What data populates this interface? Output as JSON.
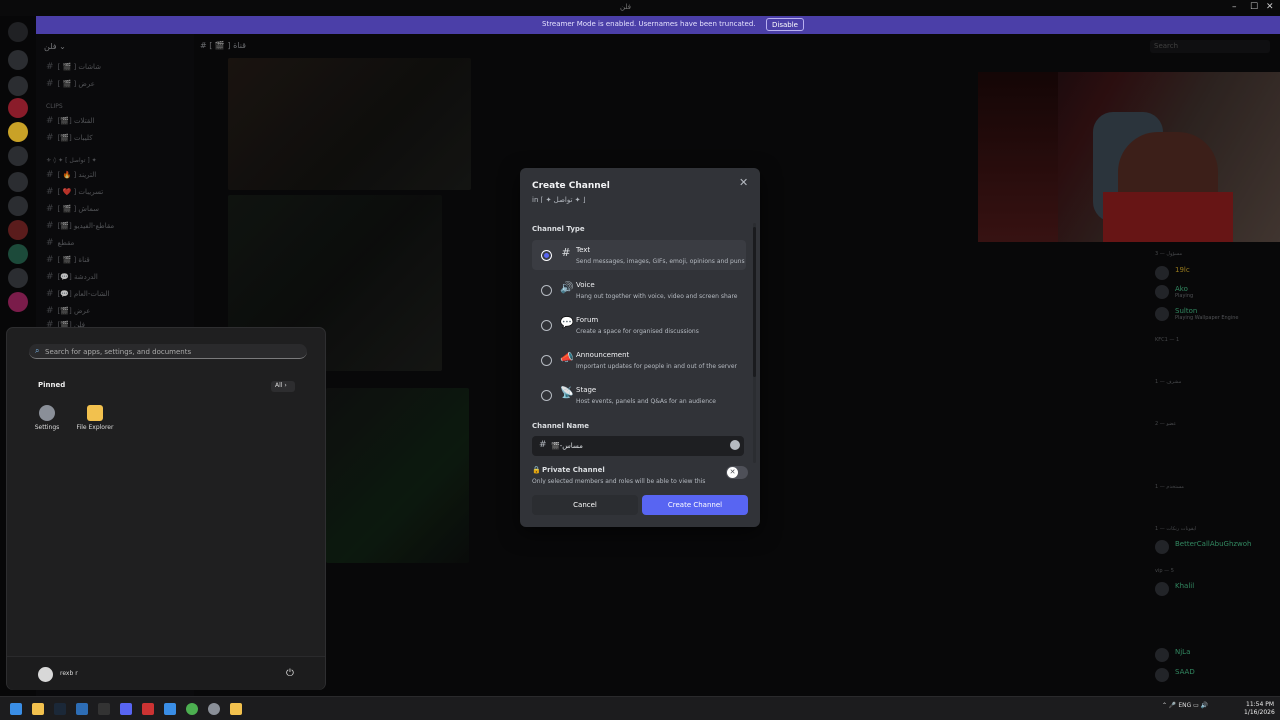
{
  "window": {
    "title": "فلن"
  },
  "banner": {
    "text": "Streamer Mode is enabled. Usernames have been truncated.",
    "disable_label": "Disable"
  },
  "server": {
    "name": "فلن ⌄"
  },
  "channel_list": {
    "items": [
      {
        "label": "[ 🎬 ] شاشات"
      },
      {
        "label": "[ 🎬 ] عرض"
      },
      {
        "label": "[🎬] القتلات"
      },
      {
        "label": "[🎬] كليبات"
      },
      {
        "label": "[ 🔥 ] التريند"
      },
      {
        "label": "[ ❤️ ] تسريبات"
      },
      {
        "label": "[ 🎬 ] سماش"
      },
      {
        "label": "[🎬] مقاطع-الفيديو"
      },
      {
        "label": "مقطع"
      },
      {
        "label": "[ 🎬 ] قناة"
      },
      {
        "label": "[💬] الدردشة"
      },
      {
        "label": "[💬] الشات-العام"
      },
      {
        "label": "[🎬] عرض"
      },
      {
        "label": "[🎬] فلن"
      }
    ],
    "categories": [
      "CLIPS",
      "⚜ ◊ ✦ [ تواصل ] ✦"
    ]
  },
  "chat_header": {
    "name": "[ 🎬 ] قناة",
    "search_placeholder": "Search"
  },
  "members": {
    "groups": [
      {
        "label": "مسؤول — 3"
      },
      {
        "label": "KFC1 — 1"
      },
      {
        "label": "مشرف — 1"
      },
      {
        "label": "عضو — 2"
      },
      {
        "label": "مستخدم — 1"
      },
      {
        "label": "ايقونات رنكات — 1"
      },
      {
        "label": "vip — 5"
      }
    ],
    "list": [
      {
        "name": "19lc",
        "status": "",
        "color": "#c9a227"
      },
      {
        "name": "Ako",
        "status": "Playing",
        "color": "#43b581"
      },
      {
        "name": "Sulton",
        "status": "Playing Wallpaper Engine",
        "color": "#43b581"
      },
      {
        "name": "BetterCallAbuGhzwoh",
        "status": "",
        "color": "#43b581"
      },
      {
        "name": "Khalil",
        "status": "",
        "color": "#43b581"
      },
      {
        "name": "NjLa",
        "status": "",
        "color": "#43b581"
      },
      {
        "name": "SAAD",
        "status": "",
        "color": "#43b581"
      }
    ]
  },
  "start_menu": {
    "search_placeholder": "Search for apps, settings, and documents",
    "pinned_label": "Pinned",
    "all_label": "All",
    "apps": [
      {
        "label": "Settings",
        "icon": "gear-icon",
        "color": "#8a8f98"
      },
      {
        "label": "File Explorer",
        "icon": "folder-icon",
        "color": "#f2c14e"
      }
    ],
    "user_name": "rexb r"
  },
  "modal": {
    "title": "Create Channel",
    "subtitle": "in ⌈ ✦ تواصل ✦ ⌋",
    "channel_type_label": "Channel Type",
    "options": [
      {
        "label": "Text",
        "desc": "Send messages, images, GIFs, emoji, opinions and puns",
        "icon": "#",
        "selected": true
      },
      {
        "label": "Voice",
        "desc": "Hang out together with voice, video and screen share",
        "icon": "🔊",
        "selected": false
      },
      {
        "label": "Forum",
        "desc": "Create a space for organised discussions",
        "icon": "💬",
        "selected": false
      },
      {
        "label": "Announcement",
        "desc": "Important updates for people in and out of the server",
        "icon": "📣",
        "selected": false
      },
      {
        "label": "Stage",
        "desc": "Host events, panels and Q&As for an audience",
        "icon": "📡",
        "selected": false
      }
    ],
    "channel_name_label": "Channel Name",
    "channel_name_value": "🎬-مساس",
    "private_label": "Private Channel",
    "private_desc": "Only selected members and roles will be able to view this",
    "private_enabled": false,
    "cancel_label": "Cancel",
    "create_label": "Create Channel",
    "accent": "#5865f2"
  },
  "taskbar": {
    "language": "ENG",
    "time": "11:54 PM",
    "date": "1/16/2026"
  }
}
